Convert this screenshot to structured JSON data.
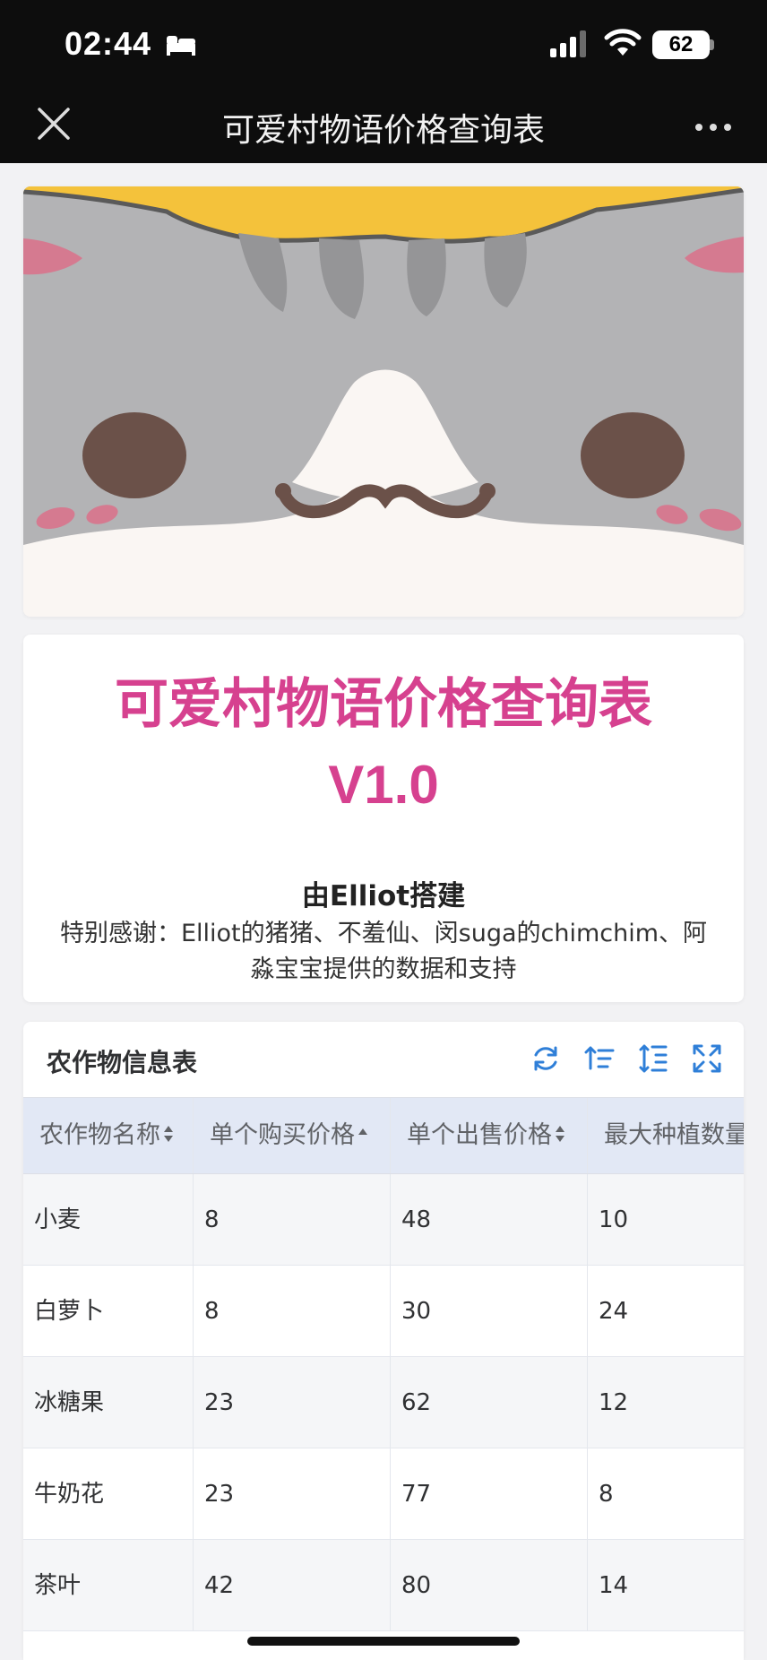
{
  "status_bar": {
    "time": "02:44",
    "battery": "62",
    "icons": [
      "bed-icon",
      "signal-icon",
      "wifi-icon",
      "battery-icon"
    ]
  },
  "nav": {
    "title": "可爱村物语价格查询表",
    "close_icon": "close-icon",
    "more_icon": "more-icon"
  },
  "header": {
    "title": "可爱村物语价格查询表",
    "version": "V1.0",
    "builder": "由Elliot搭建",
    "thanks": "特别感谢：Elliot的猪猪、不羞仙、闵suga的chimchim、阿淼宝宝提供的数据和支持"
  },
  "table": {
    "title": "农作物信息表",
    "toolbar_icons": [
      "refresh-icon",
      "sort-icon",
      "column-settings-icon",
      "fullscreen-icon"
    ],
    "columns": [
      "农作物名称",
      "单个购买价格",
      "单个出售价格",
      "最大种植数量"
    ],
    "rows": [
      [
        "小麦",
        "8",
        "48",
        "10"
      ],
      [
        "白萝卜",
        "8",
        "30",
        "24"
      ],
      [
        "冰糖果",
        "23",
        "62",
        "12"
      ],
      [
        "牛奶花",
        "23",
        "77",
        "8"
      ],
      [
        "茶叶",
        "42",
        "80",
        "14"
      ]
    ]
  },
  "colors": {
    "accent_pink": "#d6418f",
    "toolbar_blue": "#2f7fd8",
    "header_bg": "#e2e8f5",
    "bar_bg": "#0d0d0d"
  }
}
